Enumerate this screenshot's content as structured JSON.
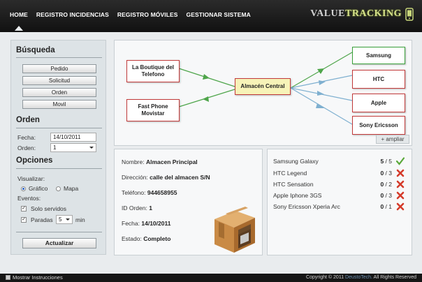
{
  "nav": {
    "items": [
      "HOME",
      "REGISTRO INCIDENCIAS",
      "REGISTRO MÓVILES",
      "GESTIONAR SISTEMA"
    ],
    "logo_pre": "VALUE",
    "logo_post": "TRACKING"
  },
  "sidebar": {
    "busqueda_title": "Búsqueda",
    "busqueda_buttons": [
      "Pedido",
      "Solicitud",
      "Orden",
      "Movil"
    ],
    "orden_title": "Orden",
    "fecha_label": "Fecha:",
    "fecha_value": "14/10/2011",
    "orden_label": "Orden:",
    "orden_value": "1",
    "opciones_title": "Opciones",
    "visualizar_label": "Visualizar:",
    "grafico_label": "Gráfico",
    "mapa_label": "Mapa",
    "eventos_label": "Eventos:",
    "solo_servidos_label": "Solo servidos",
    "paradas_label": "Paradas",
    "paradas_value": "5",
    "min_label": "min",
    "actualizar_label": "Actualizar"
  },
  "diagram": {
    "central": "Almacén Central",
    "left_nodes": [
      "La Boutique del Telefono",
      "Fast Phone Movistar"
    ],
    "right_nodes": [
      "Samsung",
      "HTC",
      "Apple",
      "Sony Ericsson"
    ],
    "ampliar_label": "+ ampliar",
    "colors": {
      "green_arrow": "#4ea54a",
      "blue_arrow": "#7fb0d0",
      "red_border": "#c23a3a",
      "green_border": "#3aa13a"
    }
  },
  "info": {
    "nombre_label": "Nombre:",
    "nombre_value": "Almacen Principal",
    "direccion_label": "Dirección:",
    "direccion_value": "calle del almacen S/N",
    "telefono_label": "Teléfono:",
    "telefono_value": "944658955",
    "id_label": "ID Orden:",
    "id_value": "1",
    "fecha_label": "Fecha:",
    "fecha_value": "14/10/2011",
    "estado_label": "Estado:",
    "estado_value": "Completo"
  },
  "list": {
    "items": [
      {
        "name": "Samsung Galaxy",
        "done": "5",
        "total": "/ 5",
        "status": "check-icon"
      },
      {
        "name": "HTC Legend",
        "done": "0",
        "total": "/ 3",
        "status": "cross-icon"
      },
      {
        "name": "HTC Sensation",
        "done": "0",
        "total": "/ 2",
        "status": "cross-icon"
      },
      {
        "name": "Apple Iphone 3GS",
        "done": "0",
        "total": "/ 3",
        "status": "cross-icon"
      },
      {
        "name": "Sony Ericsson Xperia Arc",
        "done": "0",
        "total": "/ 1",
        "status": "cross-icon"
      }
    ]
  },
  "footer": {
    "instrucciones_label": "Mostrar Instrucciones",
    "copyright_pre": "Copyright © 2011",
    "copyright_brand": "DeustoTech.",
    "copyright_post": "All Rights Reserved"
  }
}
